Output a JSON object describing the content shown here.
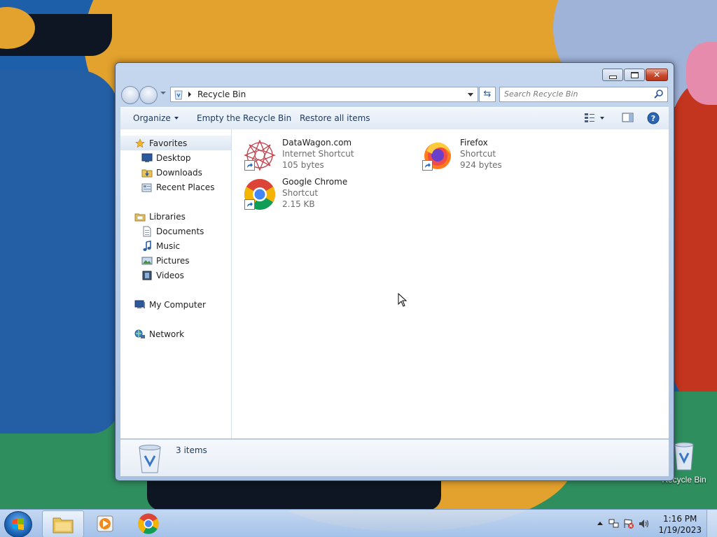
{
  "window": {
    "title": "Recycle Bin",
    "breadcrumb": "Recycle Bin",
    "search_placeholder": "Search Recycle Bin"
  },
  "toolbar": {
    "organize_label": "Organize",
    "empty_label": "Empty the Recycle Bin",
    "restore_label": "Restore all items"
  },
  "nav": {
    "favorites": {
      "label": "Favorites",
      "items": [
        "Desktop",
        "Downloads",
        "Recent Places"
      ]
    },
    "libraries": {
      "label": "Libraries",
      "items": [
        "Documents",
        "Music",
        "Pictures",
        "Videos"
      ]
    },
    "computer": "My Computer",
    "network": "Network"
  },
  "files": [
    {
      "name": "DataWagon.com",
      "type": "Internet Shortcut",
      "size": "105 bytes",
      "icon": "datawagon-icon"
    },
    {
      "name": "Firefox",
      "type": "Shortcut",
      "size": "924 bytes",
      "icon": "firefox-icon"
    },
    {
      "name": "Google Chrome",
      "type": "Shortcut",
      "size": "2.15 KB",
      "icon": "chrome-icon"
    }
  ],
  "details": {
    "count": "3 items"
  },
  "desktop": {
    "recycle_label": "Recycle Bin"
  },
  "taskbar": {
    "time": "1:16 PM",
    "date": "1/19/2023"
  },
  "colors": {
    "accent": "#1e395b",
    "window_frame": "#b4cbe8",
    "taskbar": "#c4d8f2"
  }
}
